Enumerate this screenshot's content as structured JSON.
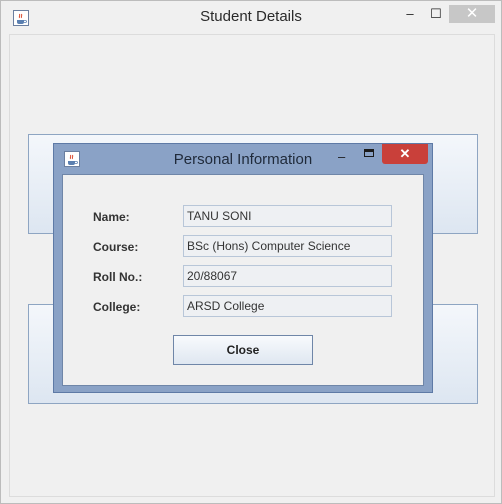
{
  "outer_window": {
    "title": "Student Details",
    "icon": "java-cup-icon",
    "min_glyph": "–",
    "max_glyph": "☐",
    "close_glyph": "✕"
  },
  "dialog": {
    "title": "Personal Information",
    "icon": "java-cup-icon",
    "min_glyph": "–",
    "close_glyph": "✕",
    "fields": [
      {
        "label": "Name:",
        "value": "TANU SONI"
      },
      {
        "label": "Course:",
        "value": "BSc (Hons) Computer Science"
      },
      {
        "label": "Roll No.:",
        "value": "20/88067"
      },
      {
        "label": "College:",
        "value": "ARSD College"
      }
    ],
    "close_button": "Close"
  }
}
